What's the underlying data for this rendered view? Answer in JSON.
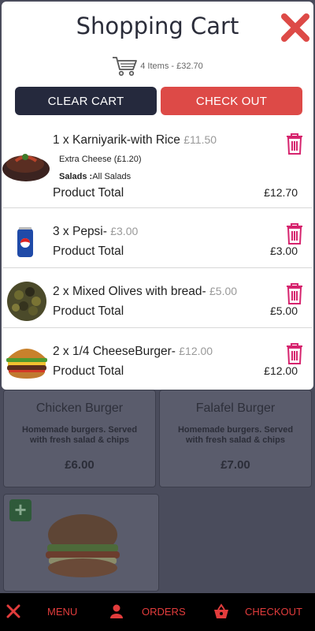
{
  "cart": {
    "title": "Shopping Cart",
    "summary": "4 Items - £32.70",
    "clear_label": "CLEAR CART",
    "checkout_label": "CHECK OUT",
    "items": [
      {
        "name": "1 x Karniyarik-with Rice",
        "unit_price": "£11.50",
        "extra": "Extra Cheese (£1.20)",
        "salads_label": "Salads :",
        "salads_value": "All Salads",
        "total_label": "Product Total",
        "total": "£12.70"
      },
      {
        "name": "3 x Pepsi-",
        "unit_price": "£3.00",
        "total_label": "Product Total",
        "total": "£3.00"
      },
      {
        "name": "2 x Mixed Olives with bread-",
        "unit_price": "£5.00",
        "total_label": "Product Total",
        "total": "£5.00"
      },
      {
        "name": "2 x 1/4 CheeseBurger-",
        "unit_price": "£12.00",
        "total_label": "Product Total",
        "total": "£12.00"
      }
    ]
  },
  "menu_background": {
    "products": [
      {
        "name": "Chicken Burger",
        "description": "Homemade burgers. Served with fresh salad & chips",
        "price": "£6.00"
      },
      {
        "name": "Falafel Burger",
        "description": "Homemade burgers. Served with fresh salad & chips",
        "price": "£7.00"
      }
    ]
  },
  "bottom_nav": {
    "menu": "MENU",
    "orders": "ORDERS",
    "checkout": "CHECKOUT"
  },
  "colors": {
    "accent_red": "#dd4a47",
    "dark_button": "#25293d",
    "trash_pink": "#d6246e"
  }
}
